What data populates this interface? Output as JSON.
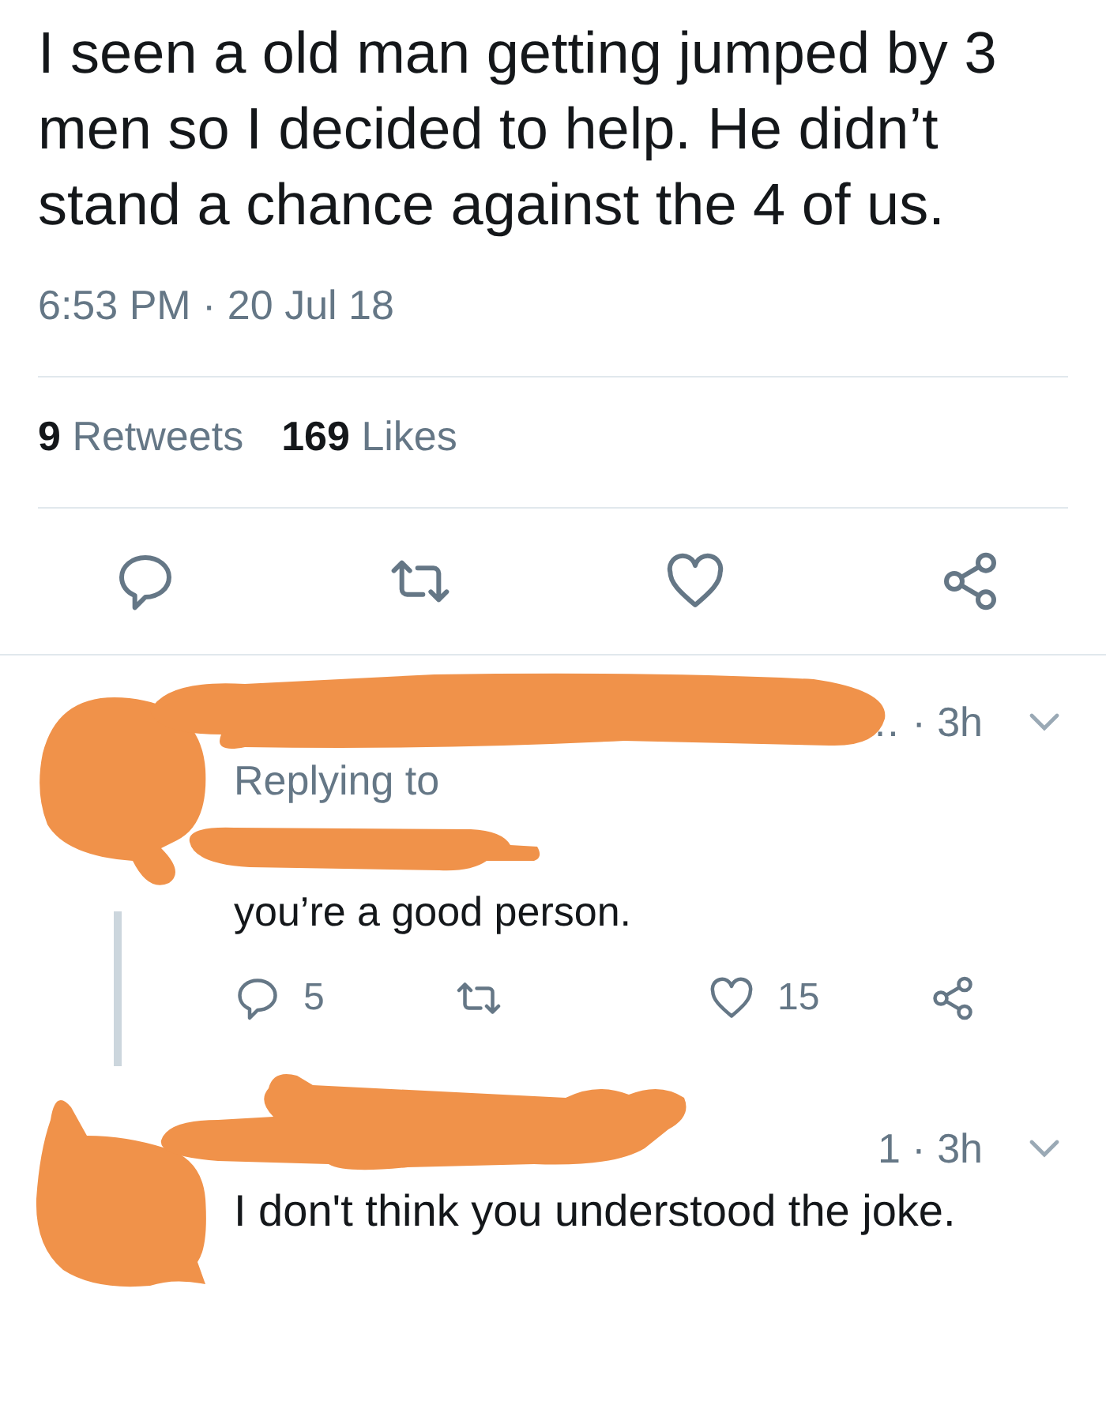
{
  "tweet": {
    "text": "I seen a old man getting jumped by 3 men so I decided to help. He didn’t stand a chance against the 4 of us.",
    "timestamp": "6:53 PM · 20 Jul 18",
    "stats": [
      {
        "count": "9",
        "label": "Retweets"
      },
      {
        "count": "169",
        "label": "Likes"
      }
    ],
    "actions": [
      {
        "kind": "reply"
      },
      {
        "kind": "retweet"
      },
      {
        "kind": "like"
      },
      {
        "kind": "share"
      }
    ]
  },
  "replies": [
    {
      "meta": "… · 3h",
      "reply_context": "Replying to",
      "text": "you’re a good person.",
      "actions": [
        {
          "kind": "reply",
          "count": "5"
        },
        {
          "kind": "retweet"
        },
        {
          "kind": "like",
          "count": "15"
        },
        {
          "kind": "share"
        }
      ]
    },
    {
      "meta": "1 · 3h",
      "text": "I don't think you understood the joke."
    }
  ]
}
